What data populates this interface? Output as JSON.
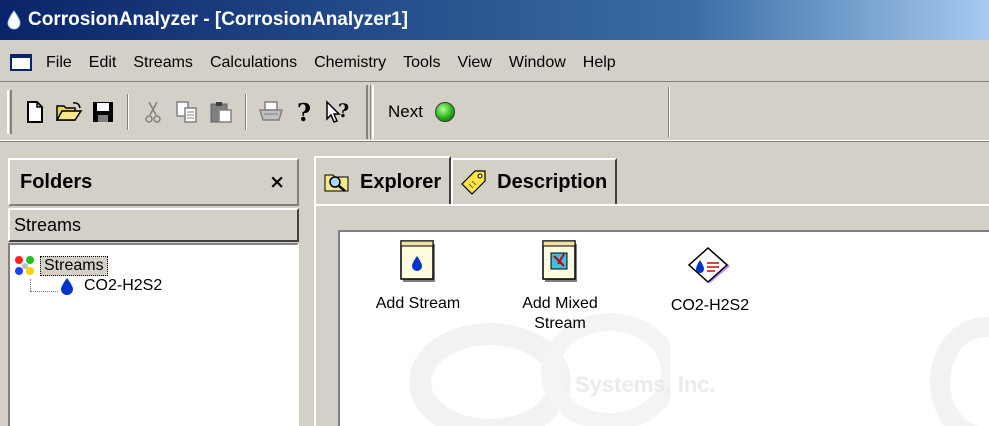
{
  "window": {
    "title": "CorrosionAnalyzer - [CorrosionAnalyzer1]"
  },
  "menu": [
    "File",
    "Edit",
    "Streams",
    "Calculations",
    "Chemistry",
    "Tools",
    "View",
    "Window",
    "Help"
  ],
  "toolbar": {
    "icons": [
      "new-icon",
      "open-icon",
      "save-icon",
      "cut-icon",
      "copy-icon",
      "paste-icon",
      "print-icon",
      "help-icon",
      "context-help-icon"
    ],
    "next_label": "Next"
  },
  "left_pane": {
    "header": "Folders",
    "close_glyph": "×",
    "section": "Streams",
    "tree": {
      "root": "Streams",
      "children": [
        "CO2-H2S2"
      ]
    }
  },
  "tabs": [
    {
      "label": "Explorer",
      "icon": "magnifier-folder-icon"
    },
    {
      "label": "Description",
      "icon": "tag-icon"
    }
  ],
  "explorer_items": [
    {
      "label": "Add Stream",
      "icon": "add-stream-icon"
    },
    {
      "label": "Add Mixed Stream",
      "icon": "add-mixed-stream-icon"
    },
    {
      "label": "CO2-H2S2",
      "icon": "stream-diamond-icon"
    }
  ],
  "watermark": {
    "text": "Systems, Inc."
  },
  "colors": {
    "titlebar": "#0a246a",
    "face": "#d4d0c8",
    "led": "#23b21a",
    "drop": "#0033cc"
  }
}
